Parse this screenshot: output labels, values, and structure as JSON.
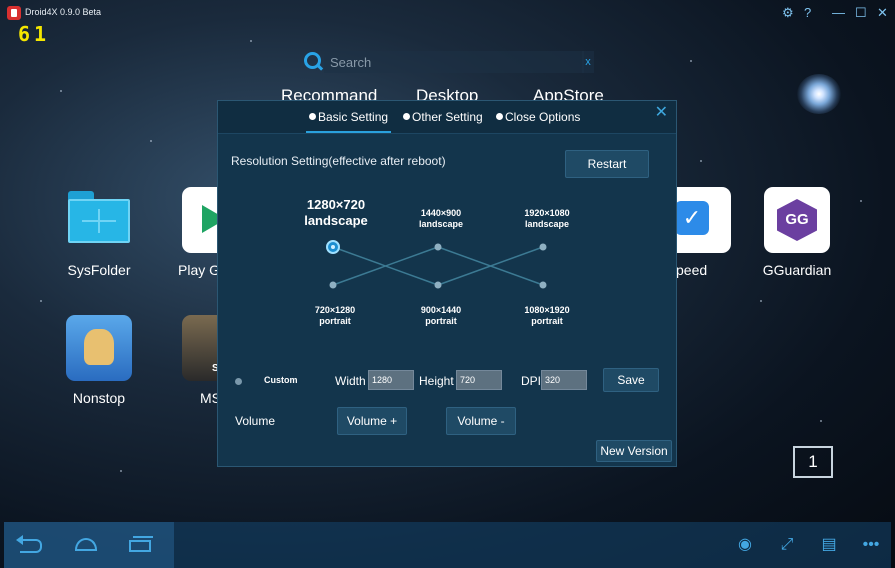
{
  "window": {
    "title": "Droid4X 0.9.0 Beta",
    "fps": "61",
    "settings_icon": "gear-icon",
    "help_label": "?",
    "minimize_label": "—",
    "maximize_label": "☐",
    "close_label": "✕"
  },
  "search": {
    "placeholder": "Search",
    "clear_label": "x"
  },
  "home_tabs": [
    "Recommand",
    "Desktop",
    "AppStore"
  ],
  "apps": [
    {
      "label": "SysFolder",
      "icon": "folder-icon"
    },
    {
      "label": "Play G",
      "icon": "play-store-icon"
    },
    {
      "label": "peed",
      "icon": "speed-icon"
    },
    {
      "label": "GGuardian",
      "icon": "gameguardian-icon"
    },
    {
      "label": "Nonstop",
      "icon": "nonstop-icon"
    },
    {
      "label": "MS",
      "icon": "ms-game-icon"
    }
  ],
  "dialog": {
    "tabs": [
      "Basic Setting",
      "Other Setting",
      "Close Options"
    ],
    "active_tab": "Basic Setting",
    "close_label": "✕",
    "resolution_title": "Resolution Setting(effective after reboot)",
    "restart_label": "Restart",
    "resolutions": {
      "top": [
        {
          "size": "1280×720",
          "mode": "landscape",
          "selected": true
        },
        {
          "size": "1440×900",
          "mode": "landscape",
          "selected": false
        },
        {
          "size": "1920×1080",
          "mode": "landscape",
          "selected": false
        }
      ],
      "bottom": [
        {
          "size": "720×1280",
          "mode": "portrait",
          "selected": false
        },
        {
          "size": "900×1440",
          "mode": "portrait",
          "selected": false
        },
        {
          "size": "1080×1920",
          "mode": "portrait",
          "selected": false
        }
      ]
    },
    "custom_label": "Custom",
    "width_label": "Width",
    "width_value": "1280",
    "height_label": "Height",
    "height_value": "720",
    "dpi_label": "DPI",
    "dpi_value": "320",
    "save_label": "Save",
    "volume_label": "Volume",
    "volume_up_label": "Volume +",
    "volume_down_label": "Volume -",
    "new_version_label": "New Version"
  },
  "page_indicator": "1",
  "colors": {
    "accent": "#2aa1dd",
    "fps": "#f4e600",
    "dialog_bg": "#13354c"
  }
}
